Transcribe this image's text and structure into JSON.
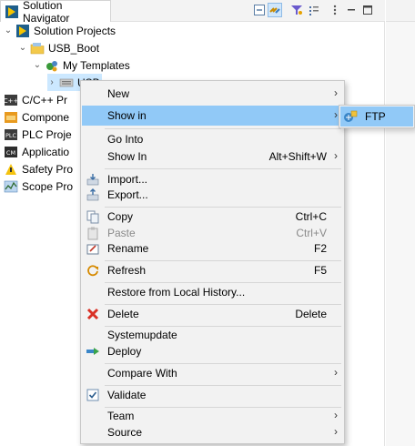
{
  "colors": {
    "selection": "#cce8ff",
    "menu_highlight": "#91c9f7",
    "menu_bg": "#f2f2f2"
  },
  "tab": {
    "title": "Solution Navigator",
    "icon": "solution-navigator-icon"
  },
  "toolbar": {
    "icons": [
      "collapse-all-icon",
      "link-with-editor-icon",
      "filter-icon",
      "view-menu-icon",
      "minimize-icon",
      "maximize-icon"
    ]
  },
  "tree": {
    "root": "Solution Projects",
    "project": "USB_Boot",
    "templates": "My Templates",
    "selected": "USB",
    "others": [
      "C/C++ Pr",
      "Compone",
      "PLC Proje",
      "Applicatio",
      "Safety Pro",
      "Scope Pro"
    ]
  },
  "menu": {
    "items": [
      {
        "label": "New",
        "shortcut": "",
        "submenu": true,
        "icon": ""
      },
      {
        "label": "Show in",
        "shortcut": "",
        "submenu": true,
        "icon": "",
        "highlighted": true
      },
      {
        "label": "Go Into",
        "shortcut": "",
        "submenu": false,
        "icon": ""
      },
      {
        "label": "Show In",
        "shortcut": "Alt+Shift+W",
        "submenu": true,
        "icon": ""
      },
      {
        "label": "Import...",
        "shortcut": "",
        "submenu": false,
        "icon": "import-icon"
      },
      {
        "label": "Export...",
        "shortcut": "",
        "submenu": false,
        "icon": "export-icon"
      },
      {
        "label": "Copy",
        "shortcut": "Ctrl+C",
        "submenu": false,
        "icon": "copy-icon"
      },
      {
        "label": "Paste",
        "shortcut": "Ctrl+V",
        "submenu": false,
        "icon": "paste-icon",
        "disabled": true
      },
      {
        "label": "Rename",
        "shortcut": "F2",
        "submenu": false,
        "icon": "rename-icon"
      },
      {
        "label": "Refresh",
        "shortcut": "F5",
        "submenu": false,
        "icon": "refresh-icon"
      },
      {
        "label": "Restore from Local History...",
        "shortcut": "",
        "submenu": false,
        "icon": ""
      },
      {
        "label": "Delete",
        "shortcut": "Delete",
        "submenu": false,
        "icon": "delete-icon"
      },
      {
        "label": "Systemupdate",
        "shortcut": "",
        "submenu": false,
        "icon": ""
      },
      {
        "label": "Deploy",
        "shortcut": "",
        "submenu": false,
        "icon": "deploy-icon"
      },
      {
        "label": "Compare With",
        "shortcut": "",
        "submenu": true,
        "icon": ""
      },
      {
        "label": "Validate",
        "shortcut": "",
        "submenu": false,
        "icon": "validate-icon"
      },
      {
        "label": "Team",
        "shortcut": "",
        "submenu": true,
        "icon": ""
      },
      {
        "label": "Source",
        "shortcut": "",
        "submenu": true,
        "icon": ""
      }
    ],
    "arrow": "›"
  },
  "submenu": {
    "label": "FTP",
    "icon": "ftp-icon"
  }
}
